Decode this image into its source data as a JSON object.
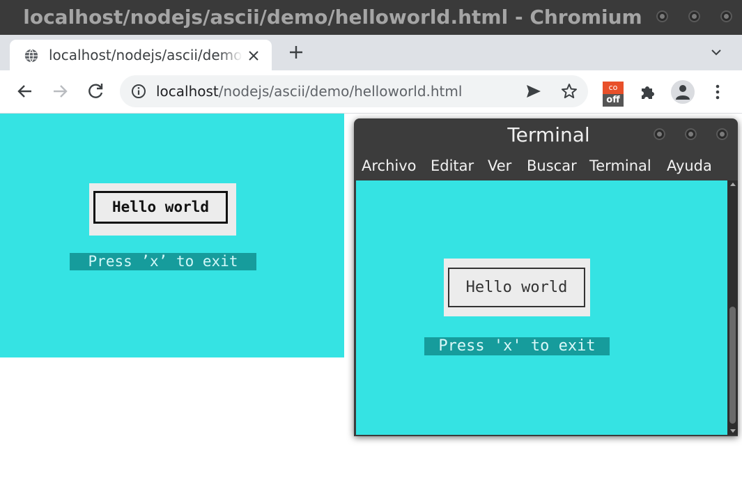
{
  "window": {
    "title": "localhost/nodejs/ascii/demo/helloworld.html - Chromium"
  },
  "tabs": [
    {
      "label": "localhost/nodejs/ascii/demo/helloworld.html",
      "icon": "globe-icon",
      "active": true
    }
  ],
  "toolbar": {
    "url_host": "localhost",
    "url_path": "/nodejs/ascii/demo/helloworld.html",
    "extension_badge_top": "co",
    "extension_badge_bottom": "off"
  },
  "page": {
    "hello_text": "Hello world",
    "press_text": "Press ’x’ to exit",
    "background_color": "#35e3e3",
    "accent_bar_color": "#169c9c"
  },
  "terminal": {
    "title": "Terminal",
    "menu": [
      "Archivo",
      "Editar",
      "Ver",
      "Buscar",
      "Terminal",
      "Ayuda"
    ],
    "hello_text": "Hello world",
    "press_text": "Press 'x' to exit"
  }
}
